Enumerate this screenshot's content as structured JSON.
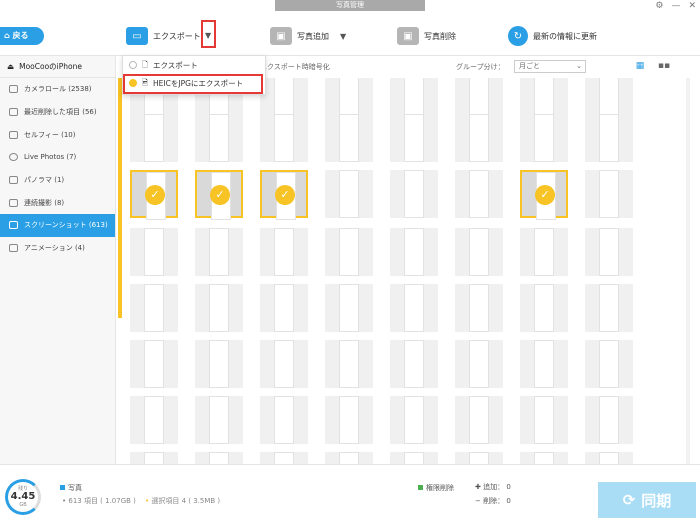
{
  "window": {
    "title": "写真管理",
    "settings_icon": "⚙",
    "minimize": "—",
    "close": "✕"
  },
  "toolbar": {
    "back": "戻る",
    "export": "エクスポート",
    "add_photo": "写真追加",
    "delete_photo": "写真削除",
    "refresh": "最新の情報に更新"
  },
  "dropdown": {
    "items": [
      {
        "label": "エクスポート"
      },
      {
        "label": "HEICをJPGにエクスポート"
      }
    ]
  },
  "subbar": {
    "encrypt": "エクスポート時暗号化",
    "group_label": "グループ分け：",
    "group_value": "月ごと"
  },
  "sidebar": {
    "device": "MooCooのiPhone",
    "items": [
      {
        "label": "カメラロール (2538)"
      },
      {
        "label": "最近削除した項目 (56)"
      },
      {
        "label": "セルフィー (10)"
      },
      {
        "label": "Live Photos (7)"
      },
      {
        "label": "パノラマ (1)"
      },
      {
        "label": "連続撮影 (8)"
      },
      {
        "label": "スクリーンショット (613)"
      },
      {
        "label": "アニメーション (4)"
      }
    ]
  },
  "footer": {
    "capacity_label": "残り",
    "capacity_value": "4.45",
    "capacity_unit": "GB",
    "photo_label": "写真",
    "items_count": "613 項目 ( 1.07GB )",
    "selected": "選択項目 4 ( 3.5MB )",
    "delete_perm": "権限削除",
    "add_count": "追加： 0",
    "del_count": "削除： 0",
    "sync": "同期"
  },
  "colors": {
    "accent": "#2a9fe5",
    "selection": "#f7c325",
    "highlight_box": "#e53935"
  }
}
